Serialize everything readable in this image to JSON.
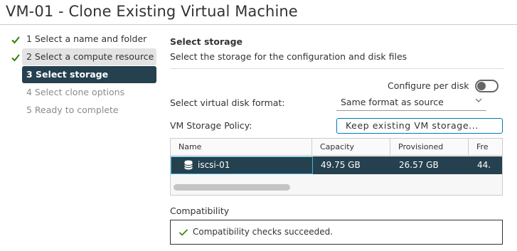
{
  "window": {
    "title": "VM-01 - Clone Existing Virtual Machine"
  },
  "steps": [
    {
      "label": "1 Select a name and folder",
      "state": "done"
    },
    {
      "label": "2 Select a compute resource",
      "state": "done"
    },
    {
      "label": "3 Select storage",
      "state": "active"
    },
    {
      "label": "4 Select clone options",
      "state": "pending"
    },
    {
      "label": "5 Ready to complete",
      "state": "pending"
    }
  ],
  "storage": {
    "heading": "Select storage",
    "description": "Select the storage for the configuration and disk files",
    "configure_per_disk": {
      "label": "Configure per disk",
      "enabled": false
    },
    "disk_format": {
      "label": "Select virtual disk format:",
      "value": "Same format as source"
    },
    "policy": {
      "label": "VM Storage Policy:",
      "value": "Keep existing VM storage..."
    }
  },
  "datastore_table": {
    "columns": [
      "Name",
      "Capacity",
      "Provisioned",
      "Fre"
    ],
    "rows": [
      {
        "name": "iscsi-01",
        "capacity": "49.75 GB",
        "provisioned": "26.57 GB",
        "free": "44."
      }
    ]
  },
  "compatibility": {
    "label": "Compatibility",
    "message": "Compatibility checks succeeded."
  },
  "colors": {
    "active_step": "#25414f",
    "check_green": "#2f8400",
    "link_blue": "#0079b8"
  }
}
